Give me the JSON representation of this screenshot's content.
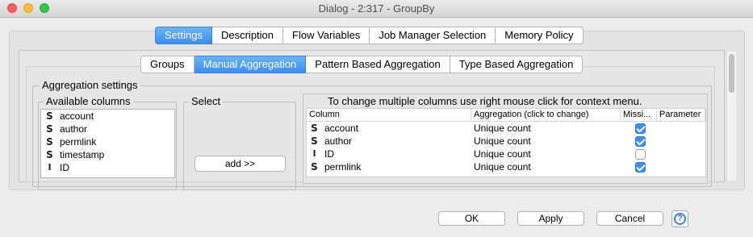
{
  "window": {
    "title": "Dialog - 2:317 - GroupBy"
  },
  "main_tabs": [
    "Settings",
    "Description",
    "Flow Variables",
    "Job Manager Selection",
    "Memory Policy"
  ],
  "main_tab_selected": "Settings",
  "sub_tabs": [
    "Groups",
    "Manual Aggregation",
    "Pattern Based Aggregation",
    "Type Based Aggregation"
  ],
  "sub_tab_selected": "Manual Aggregation",
  "aggregation": {
    "legend": "Aggregation settings",
    "available_label": "Available columns",
    "select_label": "Select",
    "add_button": "add >>",
    "available_columns": [
      {
        "type": "S",
        "name": "account"
      },
      {
        "type": "S",
        "name": "author"
      },
      {
        "type": "S",
        "name": "permlink"
      },
      {
        "type": "S",
        "name": "timestamp"
      },
      {
        "type": "I",
        "name": "ID"
      }
    ],
    "hint": "To change multiple columns use right mouse click for context menu.",
    "table_headers": [
      "Column",
      "Aggregation (click to change)",
      "Missi...",
      "Parameter"
    ],
    "rows": [
      {
        "type": "S",
        "column": "account",
        "aggregation": "Unique count",
        "missing": true
      },
      {
        "type": "S",
        "column": "author",
        "aggregation": "Unique count",
        "missing": true
      },
      {
        "type": "I",
        "column": "ID",
        "aggregation": "Unique count",
        "missing": false
      },
      {
        "type": "S",
        "column": "permlink",
        "aggregation": "Unique count",
        "missing": true
      }
    ]
  },
  "footer": {
    "ok": "OK",
    "apply": "Apply",
    "cancel": "Cancel",
    "help": "?"
  },
  "colors": {
    "selected_tab": "#3a8ff4",
    "checkbox": "#3b8ff3"
  }
}
